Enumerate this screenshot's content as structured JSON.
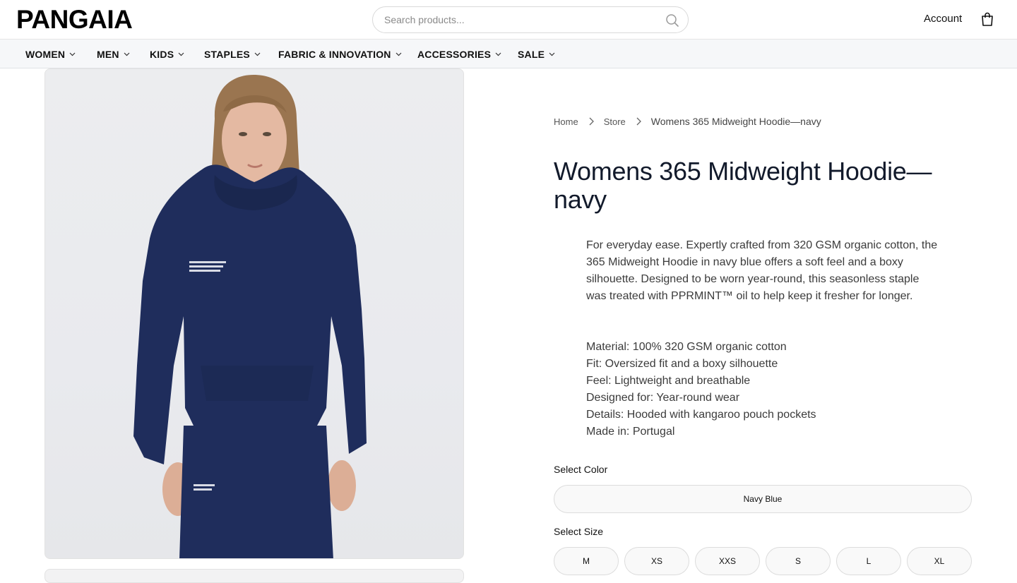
{
  "brand": {
    "logo_text": "PANGAIA"
  },
  "search": {
    "placeholder": "Search products..."
  },
  "header": {
    "account_label": "Account"
  },
  "nav": {
    "items": [
      {
        "label": "WOMEN"
      },
      {
        "label": "MEN"
      },
      {
        "label": "KIDS"
      },
      {
        "label": "STAPLES"
      },
      {
        "label": "FABRIC & INNOVATION"
      },
      {
        "label": "ACCESSORIES"
      },
      {
        "label": "SALE"
      }
    ]
  },
  "breadcrumb": {
    "items": [
      "Home",
      "Store"
    ],
    "current": "Womens 365 Midweight Hoodie—navy"
  },
  "product": {
    "title": "Womens 365 Midweight Hoodie—navy",
    "description": "For everyday ease. Expertly crafted from 320 GSM organic cotton, the 365 Midweight Hoodie in navy blue offers a soft feel and a boxy silhouette. Designed to be worn year-round, this seasonless staple was treated with PPRMINT™ oil to help keep it fresher for longer.",
    "specs": [
      "Material: 100% 320 GSM organic cotton",
      "Fit: Oversized fit and a boxy silhouette",
      "Feel: Lightweight and breathable",
      "Designed for: Year-round wear",
      "Details: Hooded with kangaroo pouch pockets",
      "Made in: Portugal"
    ],
    "hoodie_color": "#1f2d5c"
  },
  "options": {
    "color_label": "Select Color",
    "colors": [
      "Navy Blue"
    ],
    "size_label": "Select Size",
    "sizes": [
      "M",
      "XS",
      "XXS",
      "S",
      "L",
      "XL"
    ]
  },
  "icons": {
    "search": "search-icon",
    "bag": "shopping-bag-icon",
    "chevron": "chevron-down-icon",
    "breadcrumb_sep": "chevron-right-icon"
  }
}
